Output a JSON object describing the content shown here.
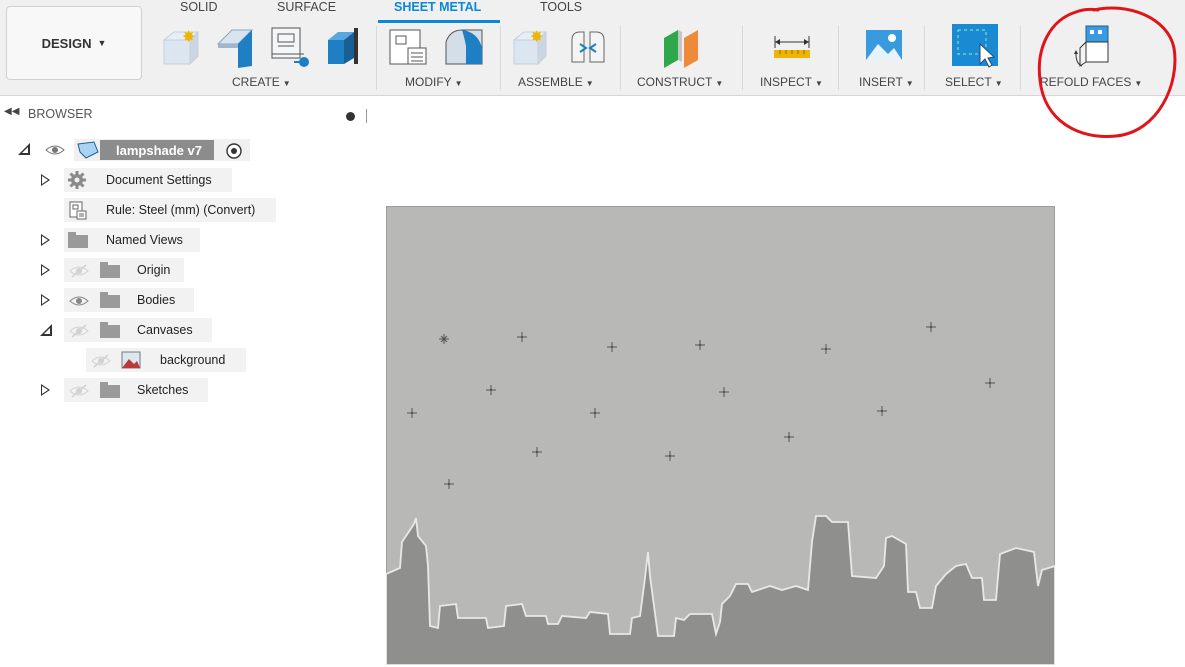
{
  "toolbar": {
    "design_label": "DESIGN",
    "tabs": [
      "SOLID",
      "SURFACE",
      "SHEET METAL",
      "TOOLS"
    ],
    "active_tab": "SHEET METAL",
    "groups": {
      "create": "CREATE",
      "modify": "MODIFY",
      "assemble": "ASSEMBLE",
      "construct": "CONSTRUCT",
      "inspect": "INSPECT",
      "insert": "INSERT",
      "select": "SELECT",
      "refold": "REFOLD FACES"
    },
    "accent_color": "#0a88d8",
    "annotation_color": "#e0141b"
  },
  "browser": {
    "title": "BROWSER",
    "root": "lampshade v7",
    "items": [
      {
        "label": "Document Settings",
        "icon": "gear-icon"
      },
      {
        "label": "Rule: Steel (mm) (Convert)",
        "icon": "rule-icon"
      },
      {
        "label": "Named Views",
        "icon": "folder-icon"
      },
      {
        "label": "Origin",
        "icon": "folder-icon"
      },
      {
        "label": "Bodies",
        "icon": "folder-icon"
      },
      {
        "label": "Canvases",
        "icon": "folder-icon"
      },
      {
        "label": "background",
        "icon": "image-icon"
      },
      {
        "label": "Sketches",
        "icon": "folder-icon"
      }
    ]
  },
  "canvas": {
    "background_color": "#b8b8b6",
    "skyline_color": "#8f8f8d"
  }
}
